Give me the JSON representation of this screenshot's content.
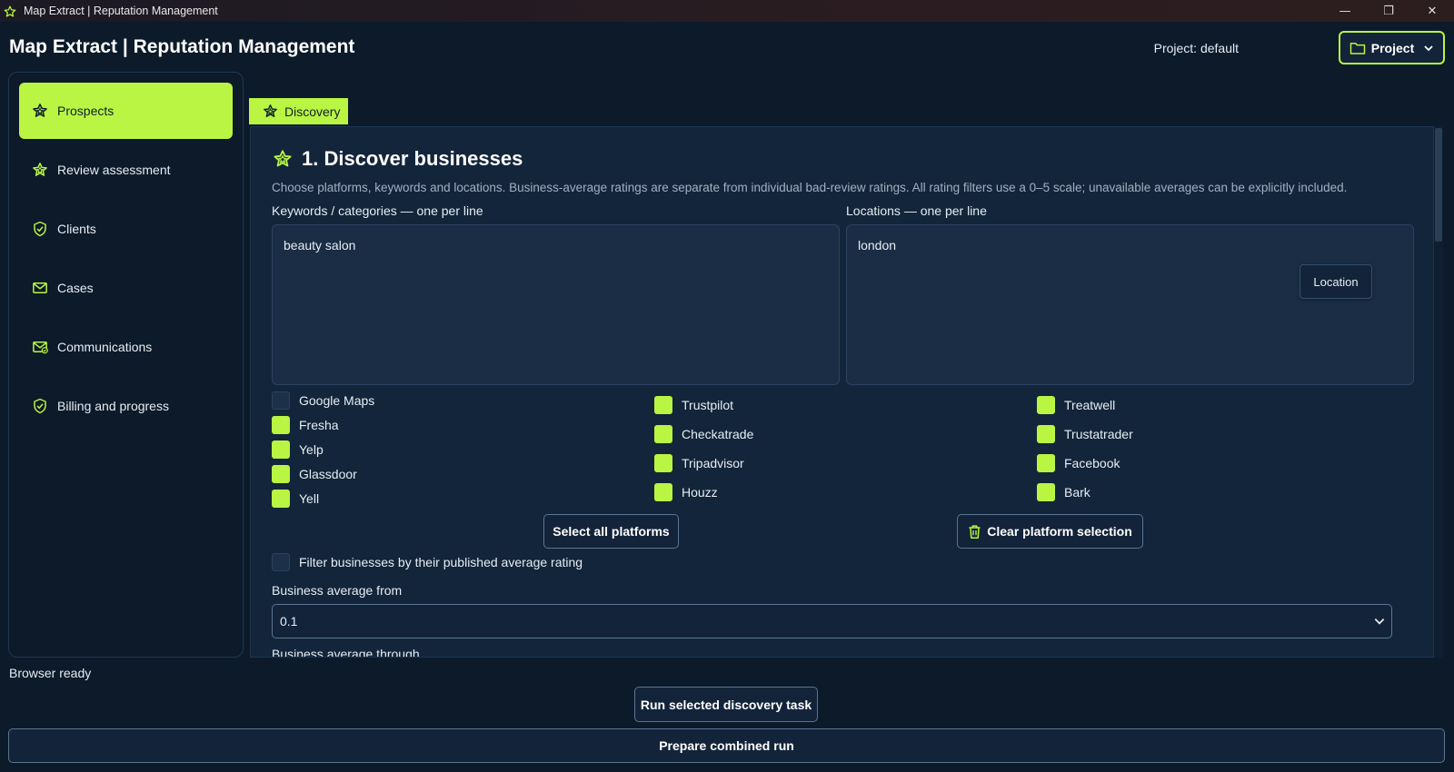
{
  "window": {
    "title": "Map Extract | Reputation Management",
    "minimize_glyph": "—",
    "maximize_glyph": "❐",
    "close_glyph": "✕"
  },
  "header": {
    "app_title": "Map Extract | Reputation Management",
    "project_label": "Project: default",
    "project_button": "Project"
  },
  "sidebar": {
    "items": [
      {
        "label": "Prospects",
        "icon": "star-icon",
        "active": true
      },
      {
        "label": "Review assessment",
        "icon": "star-icon",
        "active": false
      },
      {
        "label": "Clients",
        "icon": "shield-check-icon",
        "active": false
      },
      {
        "label": "Cases",
        "icon": "mail-icon",
        "active": false
      },
      {
        "label": "Communications",
        "icon": "mail-check-icon",
        "active": false
      },
      {
        "label": "Billing and progress",
        "icon": "shield-check-icon",
        "active": false
      }
    ]
  },
  "status": "Browser ready",
  "tabs": [
    {
      "label": "Discovery",
      "icon": "star-icon",
      "active": true
    }
  ],
  "discovery": {
    "title": "1. Discover businesses",
    "description": "Choose platforms, keywords and locations. Business-average ratings are separate from individual bad-review ratings. All rating filters use a 0–5 scale; unavailable averages can be explicitly included.",
    "keywords_label": "Keywords / categories — one per line",
    "keywords_value": "beauty salon",
    "locations_label": "Locations — one per line",
    "locations_value": "london",
    "location_button": "Location",
    "platforms_col1": [
      {
        "label": "Google Maps",
        "checked": false
      },
      {
        "label": "Fresha",
        "checked": true
      },
      {
        "label": "Yelp",
        "checked": true
      },
      {
        "label": "Glassdoor",
        "checked": true
      },
      {
        "label": "Yell",
        "checked": true
      }
    ],
    "platforms_col2": [
      {
        "label": "Trustpilot",
        "checked": true
      },
      {
        "label": "Checkatrade",
        "checked": true
      },
      {
        "label": "Tripadvisor",
        "checked": true
      },
      {
        "label": "Houzz",
        "checked": true
      }
    ],
    "platforms_col3": [
      {
        "label": "Treatwell",
        "checked": true
      },
      {
        "label": "Trustatrader",
        "checked": true
      },
      {
        "label": "Facebook",
        "checked": true
      },
      {
        "label": "Bark",
        "checked": true
      }
    ],
    "select_all_button": "Select all platforms",
    "clear_button": "Clear platform selection",
    "filter_label": "Filter businesses by their published average rating",
    "filter_checked": false,
    "avg_from_label": "Business average from",
    "avg_from_value": "0.1",
    "avg_through_label": "Business average through"
  },
  "footer": {
    "run_button": "Run selected discovery task",
    "combined_button": "Prepare combined run"
  },
  "colors": {
    "accent": "#b9f542",
    "background": "#0c1a2a",
    "panel": "#13253a"
  }
}
